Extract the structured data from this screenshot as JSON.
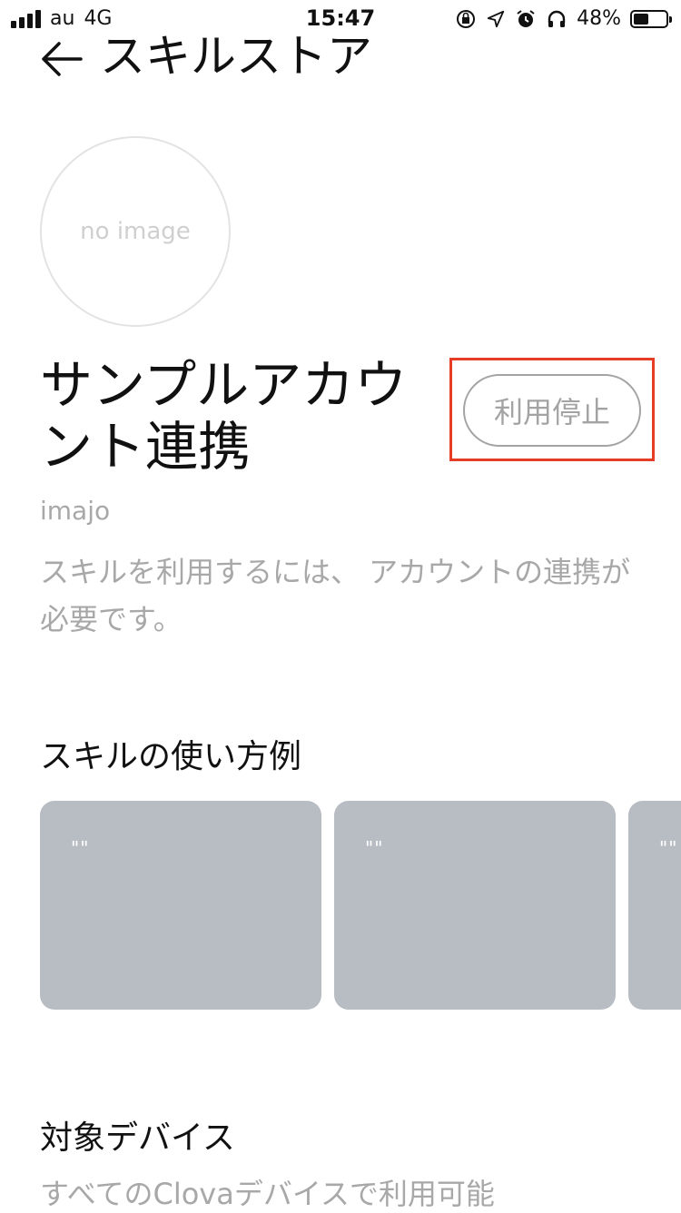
{
  "status_bar": {
    "carrier": "au",
    "network": "4G",
    "time": "15:47",
    "battery_percent": "48%",
    "battery_level": 0.48,
    "icons": [
      "rotation-lock-icon",
      "location-arrow-icon",
      "alarm-icon",
      "headphones-icon"
    ]
  },
  "header": {
    "title": "スキルストア",
    "back_icon": "arrow-left-icon"
  },
  "skill": {
    "thumbnail_text": "no image",
    "title": "サンプルアカウント連携",
    "author": "imajo",
    "stop_button_label": "利用停止",
    "description": "スキルを利用するには、 アカウントの連携が必要です。"
  },
  "usage": {
    "title": "スキルの使い方例",
    "cards": [
      {
        "text": "\"\""
      },
      {
        "text": "\"\""
      },
      {
        "text": "\"\""
      }
    ]
  },
  "devices": {
    "title": "対象デバイス",
    "text": "すべてのClovaデバイスで利用可能"
  },
  "colors": {
    "highlight": "#e53d26",
    "card": "#b8bcc3",
    "muted_text": "#a8a8a8"
  }
}
